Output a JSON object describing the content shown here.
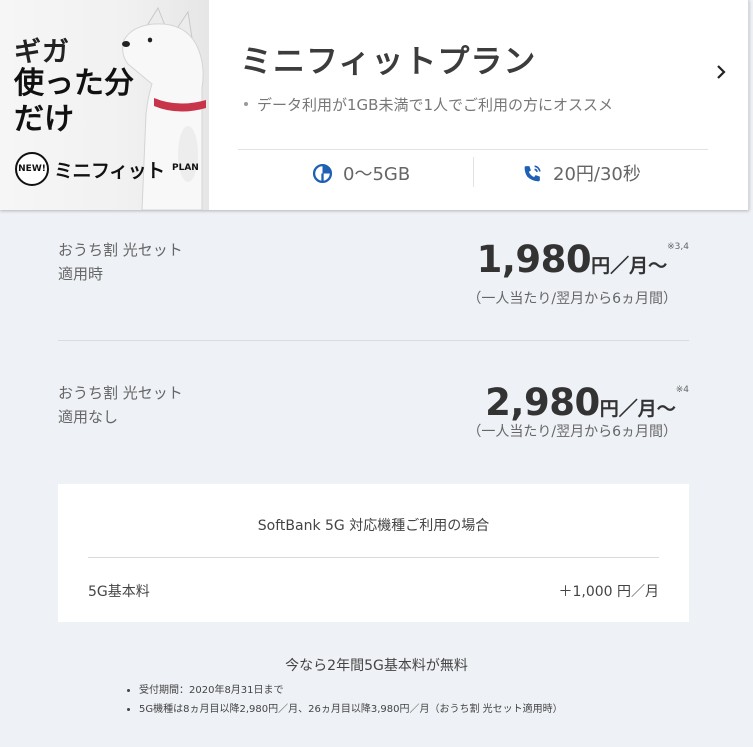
{
  "banner": {
    "line1": "ギガ",
    "line2a": "使った分",
    "line2b": "だけ",
    "new_badge": "NEW!",
    "logo_text": "ミニフィット",
    "logo_suffix": "PLAN"
  },
  "plan": {
    "title": "ミニフィットプラン",
    "description": "データ利用が1GB未満で1人でご利用の方にオススメ",
    "data_spec": "0～5GB",
    "call_spec": "20円/30秒",
    "icons": {
      "data": "pie-chart-icon",
      "call": "phone-call-icon",
      "more": "chevron-right-icon"
    },
    "accent_color": "#1f5fb4"
  },
  "prices": [
    {
      "label_line1": "おうち割 光セット",
      "label_line2": "適用時",
      "amount": "1,980",
      "unit": "円／月～",
      "note": "※3,4",
      "sub": "（一人当たり/翌月から6ヵ月間）"
    },
    {
      "label_line1": "おうち割 光セット",
      "label_line2": "適用なし",
      "amount": "2,980",
      "unit": "円／月～",
      "note": "※4",
      "sub": "（一人当たり/翌月から6ヵ月間）"
    }
  ],
  "box5g": {
    "heading": "SoftBank 5G 対応機種ご利用の場合",
    "fee_label": "5G基本料",
    "fee_value": "＋1,000 円／月"
  },
  "campaign": {
    "title": "今なら2年間5G基本料が無料",
    "items": [
      "受付期間：2020年8月31日まで",
      "5G機種は8ヵ月目以降2,980円／月、26ヵ月目以降3,980円／月（おうち割 光セット適用時）"
    ]
  }
}
